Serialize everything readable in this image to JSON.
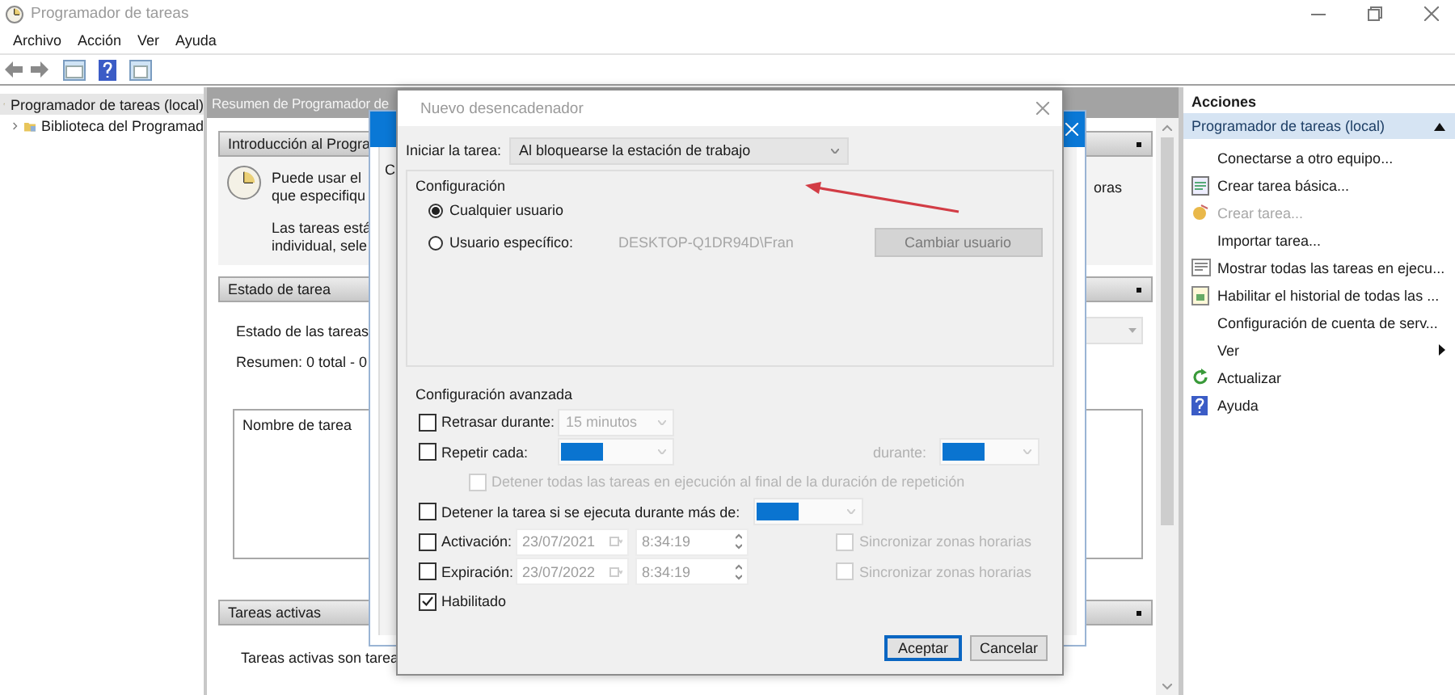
{
  "window": {
    "title": "Programador de tareas"
  },
  "menu": [
    {
      "label": "Archivo"
    },
    {
      "label": "Acción"
    },
    {
      "label": "Ver"
    },
    {
      "label": "Ayuda"
    }
  ],
  "tree": {
    "label": "Programador de tareas (local)",
    "selected": true,
    "children": [
      {
        "label": "Biblioteca del Programad",
        "expanded": false,
        "selected": false
      }
    ]
  },
  "summary": {
    "header": "Resumen de Programador de",
    "sections": [
      {
        "kind": "intro",
        "title": "Introducción al Progra",
        "paragraphs": [
          [
            "Puede usar el",
            "que especifiqu"
          ],
          [
            "Las tareas está",
            "individual, sele"
          ]
        ],
        "fragment": "oras"
      },
      {
        "kind": "status",
        "title": "Estado de tarea",
        "lines": [
          "Estado de las tareas",
          "Resumen: 0 total - 0"
        ],
        "column": "Nombre de tarea"
      },
      {
        "kind": "active",
        "title": "Tareas activas",
        "lines": [
          "Tareas activas son tarea"
        ]
      }
    ]
  },
  "back_dialog": {
    "fragment": "C"
  },
  "dialog": {
    "title": "Nuevo desencadenador",
    "start_label": "Iniciar la tarea:",
    "start_value": "Al bloquearse la estación de trabajo",
    "config_title": "Configuración",
    "radios": [
      {
        "label": "Cualquier usuario",
        "selected": true
      },
      {
        "label": "Usuario específico:",
        "selected": false
      }
    ],
    "user_value": "DESKTOP-Q1DR94D\\Fran",
    "change_user": {
      "label": "Cambiar usuario",
      "disabled": true
    },
    "advanced_title": "Configuración avanzada",
    "rows": [
      {
        "kind": "combo",
        "label": "Retrasar durante:",
        "checked": false,
        "disabled": false,
        "value": "15 minutos",
        "highlighted": false
      },
      {
        "kind": "repeat",
        "label": "Repetir cada:",
        "checked": false,
        "disabled": false,
        "highlighted": true,
        "during_label": "durante:"
      },
      {
        "kind": "sub",
        "label": "Detener todas las tareas en ejecución al final de la duración de repetición",
        "checked": false,
        "disabled": true
      },
      {
        "kind": "combo",
        "label": "Detener la tarea si se ejecuta durante más de:",
        "checked": false,
        "disabled": false,
        "highlighted": true
      },
      {
        "kind": "datetime",
        "label": "Activación:",
        "checked": false,
        "disabled": false,
        "date": "23/07/2021",
        "time": "8:34:19",
        "sync_label": "Sincronizar zonas horarias",
        "sync_checked": false
      },
      {
        "kind": "datetime",
        "label": "Expiración:",
        "checked": false,
        "disabled": false,
        "date": "23/07/2022",
        "time": "8:34:19",
        "sync_label": "Sincronizar zonas horarias",
        "sync_checked": false
      },
      {
        "kind": "check",
        "label": "Habilitado",
        "checked": true,
        "disabled": false
      }
    ],
    "buttons": [
      {
        "label": "Aceptar",
        "default": true
      },
      {
        "label": "Cancelar",
        "default": false
      }
    ],
    "annotation": {
      "kind": "arrow"
    }
  },
  "actions": {
    "title": "Acciones",
    "group": {
      "label": "Programador de tareas (local)",
      "expanded": true
    },
    "items": [
      {
        "label": "Conectarse a otro equipo...",
        "kind": "none",
        "disabled": false,
        "submenu": false
      },
      {
        "label": "Crear tarea básica...",
        "kind": "basic-task",
        "disabled": false,
        "submenu": false
      },
      {
        "label": "Crear tarea...",
        "kind": "new-task",
        "disabled": true,
        "submenu": false
      },
      {
        "label": "Importar tarea...",
        "kind": "none",
        "disabled": false,
        "submenu": false
      },
      {
        "label": "Mostrar todas las tareas en ejecu...",
        "kind": "list",
        "disabled": false,
        "submenu": false
      },
      {
        "label": "Habilitar el historial de todas las ...",
        "kind": "history",
        "disabled": false,
        "submenu": false
      },
      {
        "label": "Configuración de cuenta de serv...",
        "kind": "none",
        "disabled": false,
        "submenu": false
      },
      {
        "label": "Ver",
        "kind": "none",
        "disabled": false,
        "submenu": true
      },
      {
        "label": "Actualizar",
        "kind": "refresh",
        "disabled": false,
        "submenu": false
      },
      {
        "label": "Ayuda",
        "kind": "help",
        "disabled": false,
        "submenu": false
      }
    ]
  }
}
